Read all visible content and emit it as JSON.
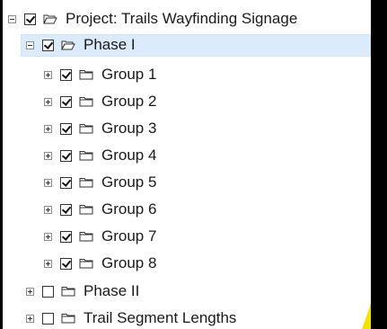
{
  "tree": {
    "project": {
      "label": "Project: Trails Wayfinding Signage",
      "checked": true,
      "expanded": true
    },
    "phase1": {
      "label": "Phase I",
      "checked": true,
      "expanded": true,
      "selected": true
    },
    "groups": [
      {
        "label": "Group 1",
        "checked": true
      },
      {
        "label": "Group 2",
        "checked": true
      },
      {
        "label": "Group 3",
        "checked": true
      },
      {
        "label": "Group 4",
        "checked": true
      },
      {
        "label": "Group 5",
        "checked": true
      },
      {
        "label": "Group 6",
        "checked": true
      },
      {
        "label": "Group 7",
        "checked": true
      },
      {
        "label": "Group 8",
        "checked": true
      }
    ],
    "phase2": {
      "label": "Phase II",
      "checked": false,
      "expanded": false
    },
    "trail_segments": {
      "label": "Trail Segment Lengths",
      "checked": false,
      "expanded": false
    }
  },
  "colors": {
    "selection": "#dcebfc",
    "background": "#000000",
    "accent": "#f2e200"
  },
  "icons": {
    "expander": "expander-icon",
    "checkbox": "checkbox",
    "folder": "folder-icon",
    "open-folder": "open-folder-icon"
  }
}
